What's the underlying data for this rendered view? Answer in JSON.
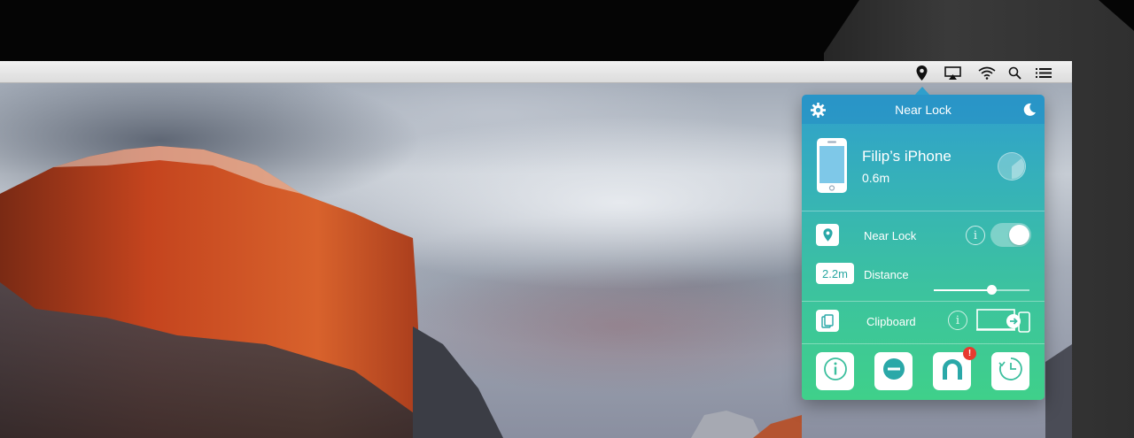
{
  "menubar": {
    "icons": [
      "location-pin-icon",
      "airplay-icon",
      "wifi-icon",
      "spotlight-search-icon",
      "notification-center-icon"
    ]
  },
  "popover": {
    "header": {
      "title": "Near Lock",
      "left_icon": "gear-icon",
      "right_icon": "moon-icon"
    },
    "device": {
      "name": "Filip’s iPhone",
      "distance": "0.6m",
      "icon": "iphone-icon",
      "signal_icon": "signal-strength-icon"
    },
    "near_lock": {
      "label": "Near Lock",
      "icon": "location-pin-icon",
      "enabled": true
    },
    "distance": {
      "badge": "2.2m",
      "label": "Distance",
      "slider_fraction": 0.6
    },
    "clipboard": {
      "label": "Clipboard",
      "icon": "clipboard-icon"
    },
    "actions": [
      {
        "icon": "info-icon",
        "badge": ""
      },
      {
        "icon": "minus-circle-icon",
        "badge": ""
      },
      {
        "icon": "user-icon",
        "badge": "!"
      },
      {
        "icon": "history-clock-icon",
        "badge": ""
      }
    ]
  },
  "colors": {
    "accent_top": "#2f9fcc",
    "accent_bottom": "#3fd08a",
    "alert": "#e8392f"
  }
}
